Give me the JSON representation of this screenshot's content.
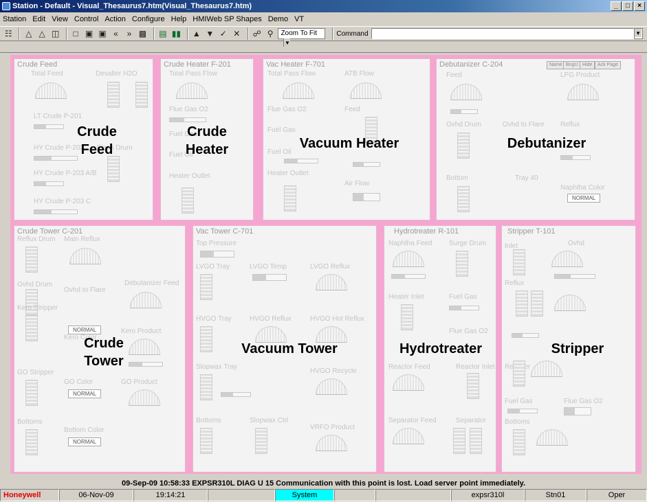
{
  "window": {
    "title": "Station - Default - Visual_Thesaurus7.htm(Visual_Thesaurus7.htm)",
    "buttons": [
      "_",
      "□",
      "×"
    ]
  },
  "menu": [
    "Station",
    "Edit",
    "View",
    "Control",
    "Action",
    "Configure",
    "Help",
    "HMIWeb SP Shapes",
    "Demo",
    "VT"
  ],
  "toolbar": {
    "zoom": "Zoom To Fit",
    "command_label": "Command",
    "command_value": ""
  },
  "panels": {
    "crude_feed": {
      "title": "Crude Feed",
      "big": "Crude\nFeed",
      "labels": [
        "Total Feed",
        "Desalter H2O",
        "LT Crude P-201",
        "HY Crude P-202",
        "Flash Drum",
        "HY Crude P-203 A/B",
        "HY Crude P-203 C"
      ]
    },
    "crude_heater": {
      "title": "Crude Heater F-201",
      "big": "Crude\nHeater",
      "labels": [
        "Total Pass Flow",
        "Flue Gas O2",
        "Fuel Gas",
        "Fuel Oil",
        "Heater Outlet"
      ]
    },
    "vac_heater": {
      "title": "Vac Heater F-701",
      "big": "Vacuum Heater",
      "labels": [
        "Total Pass Flow",
        "ATB Flow",
        "Flue Gas O2",
        "Feed",
        "Fuel Gas",
        "Fuel Oil",
        "Heater Outlet",
        "Air Flow"
      ]
    },
    "debutanizer": {
      "title": "Debutanizer C-204",
      "big": "Debutanizer",
      "labels": [
        "Feed",
        "LPG Product",
        "Ovhd Drum",
        "Ovhd to Flare",
        "Reflux",
        "Bottom",
        "Tray 40",
        "Naphtha Color"
      ],
      "badge": "NORMAL",
      "page_buttons": [
        "Name",
        "BngU",
        "Hide",
        "Ack Page"
      ]
    },
    "crude_tower": {
      "title": "Crude Tower C-201",
      "big": "Crude\nTower",
      "labels": [
        "Reflux Drum",
        "Main Reflux",
        "Ovhd Drum",
        "Ovhd to Flare",
        "Debutanizer Feed",
        "Kero Stripper",
        "Kero Color",
        "Kero Product",
        "GO Stripper",
        "GO Color",
        "GO Product",
        "Bottoms",
        "Bottom Color"
      ],
      "badges": [
        "NORMAL",
        "NORMAL",
        "NORMAL"
      ]
    },
    "vac_tower": {
      "title": "Vac Tower C-701",
      "big": "Vacuum Tower",
      "labels": [
        "Top Pressure",
        "LVGO Tray",
        "LVGO Temp",
        "LVGO Reflux",
        "HVGO Tray",
        "HVGO Reflux",
        "HVGO Hot Reflux",
        "Slopwax Tray",
        "HVGO Recycle",
        "Bottoms",
        "Slopwax Ctrl",
        "VRFO Product"
      ]
    },
    "hydrotreater": {
      "title": "Hydrotreater R-101",
      "big": "Hydrotreater",
      "labels": [
        "Naphtha Feed",
        "Surge Drum",
        "Heater Inlet",
        "Fuel Gas",
        "Flue Gas O2",
        "Reactor Feed",
        "Reactor Inlet",
        "Separator Feed",
        "Separator"
      ]
    },
    "stripper": {
      "title": "Stripper T-101",
      "big": "Stripper",
      "labels": [
        "Inlet",
        "Ovhd",
        "Reflux",
        "Reboiler",
        "Fuel Gas",
        "Flue Gas O2",
        "Bottoms"
      ]
    }
  },
  "alarm": "09-Sep-09  10:58:33  EXPSR310L  DIAG   U 15 Communication with this point is lost.  Load server point immediately.",
  "status": {
    "brand": "Honeywell",
    "date": "06-Nov-09",
    "time": "19:14:21",
    "blank1": "",
    "mode": "System",
    "blank2": "",
    "blank3": "",
    "server": "expsr310l",
    "station": "Stn01",
    "role": "Oper"
  },
  "colors": {
    "display_bg": "#f5a6d0",
    "brand": "#e00000",
    "system_bg": "#00ffff",
    "title_bar": "#0a246a"
  }
}
